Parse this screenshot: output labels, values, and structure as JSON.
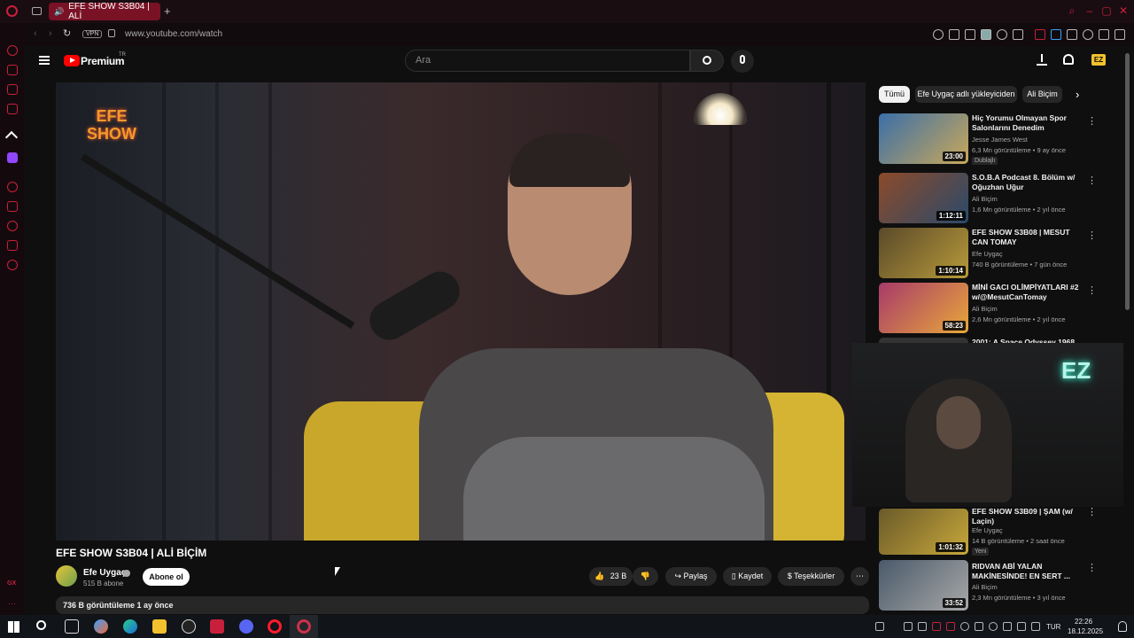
{
  "browser": {
    "tab_title": "EFE SHOW S3B04 | ALİ",
    "url": "www.youtube.com/watch",
    "vpn_label": "VPN",
    "new_tab_glyph": "+"
  },
  "header": {
    "logo_text": "Premium",
    "logo_superscript": "TR",
    "search_placeholder": "Ara"
  },
  "video": {
    "title": "EFE SHOW S3B04 | ALİ BİÇİM",
    "overlay_logo": "EFE SHOW",
    "channel": "Efe Uygaç",
    "subscribers": "515 B abone",
    "subscribe_label": "Abone ol",
    "likes": "23 B",
    "share_label": "Paylaş",
    "save_label": "Kaydet",
    "thanks_label": "Teşekkürler",
    "views_line": "736 B görüntüleme  1 ay önce"
  },
  "sidebar": {
    "chips": [
      {
        "label": "Tümü",
        "active": true
      },
      {
        "label": "Efe Uygaç adlı yükleyiciden",
        "active": false
      },
      {
        "label": "Ali Biçim",
        "active": false
      }
    ],
    "items": [
      {
        "title": "Hiç Yorumu Olmayan Spor Salonlarını Denedim",
        "channel": "Jesse James West",
        "meta": "6,3 Mn görüntüleme • 9 ay önce",
        "duration": "23:00",
        "badge": "Dublajlı",
        "thumb_color": "#3b6fa8"
      },
      {
        "title": "S.O.B.A Podcast 8. Bölüm w/ Oğuzhan Uğur",
        "channel": "Ali Biçim",
        "meta": "1,6 Mn görüntüleme • 2 yıl önce",
        "duration": "1:12:11",
        "badge": "",
        "thumb_color": "#8c4a2a"
      },
      {
        "title": "EFE SHOW S3B08 | MESUT CAN TOMAY",
        "channel": "Efe Uygaç",
        "meta": "740 B görüntüleme • 7 gün önce",
        "duration": "1:10:14",
        "badge": "",
        "thumb_color": "#5a4a2a"
      },
      {
        "title": "MİNİ GACI OLİMPİYATLARI #2 w/@MesutCanTomay",
        "channel": "Ali Biçim",
        "meta": "2,6 Mn görüntüleme • 2 yıl önce",
        "duration": "58:23",
        "badge": "",
        "thumb_color": "#a83a6a"
      },
      {
        "title": "2001: A Space Odyssey 1968",
        "channel": "",
        "meta": "",
        "duration": "",
        "badge": "",
        "thumb_color": "#333333"
      },
      {
        "title": "EFE SHOW S3B09 | ŞAM (w/ Laçin)",
        "channel": "Efe Uygaç",
        "meta": "14 B görüntüleme • 2 saat önce",
        "duration": "1:01:32",
        "badge": "Yeni",
        "thumb_color": "#6a5a2a"
      },
      {
        "title": "RIDVAN ABİ YALAN MAKİNESİNDE! EN SERT ...",
        "channel": "Ali Biçim",
        "meta": "2,3 Mn görüntüleme • 3 yıl önce",
        "duration": "33:52",
        "badge": "",
        "thumb_color": "#4a5a6a"
      }
    ]
  },
  "webcam": {
    "neon_text": "EZ"
  },
  "taskbar": {
    "lang": "TUR",
    "time": "22:26",
    "date": "18.12.2025"
  },
  "colors": {
    "accent": "#c8203c",
    "yt_red": "#ff0000",
    "background": "#0f0f0f"
  }
}
